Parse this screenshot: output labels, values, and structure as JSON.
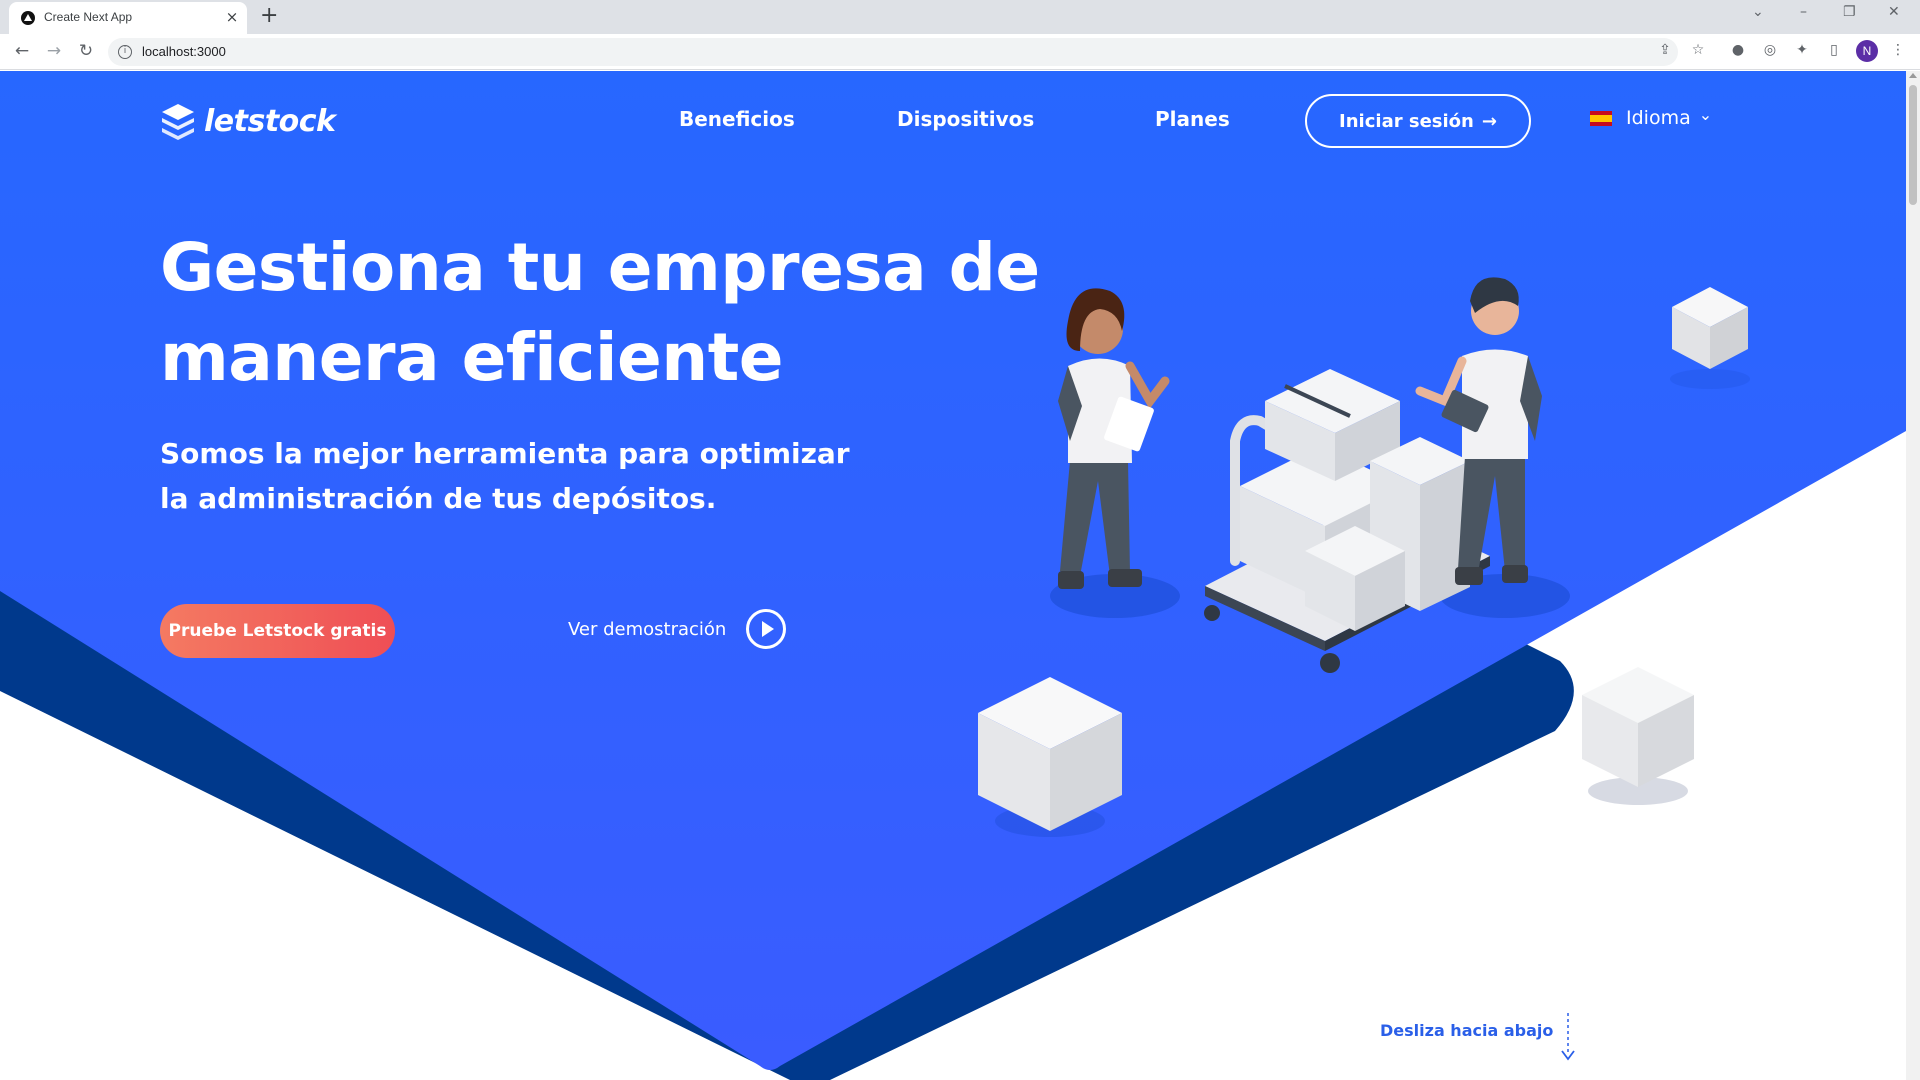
{
  "browser": {
    "tab_title": "Create Next App",
    "new_tab_symbol": "+",
    "tab_close_symbol": "×",
    "url": "localhost:3000",
    "profile_initial": "N"
  },
  "brand": {
    "name": "letstock"
  },
  "nav": {
    "links": [
      "Beneficios",
      "Dispositivos",
      "Planes"
    ],
    "login_label": "Iniciar sesión",
    "login_arrow": "→",
    "language_label": "Idioma",
    "language_chevron": "⌄"
  },
  "hero": {
    "headline_line1": "Gestiona tu empresa de",
    "headline_line2": "manera eficiente",
    "subline": "Somos la mejor herramienta para optimizar la administración de tus depósitos.",
    "cta_label": "Pruebe Letstock gratis",
    "demo_label": "Ver demostración"
  },
  "scroll_hint": "Desliza hacia abajo",
  "colors": {
    "primary_blue": "#2962ff",
    "dark_blue": "#00398c",
    "cta_start": "#f47a62",
    "cta_end": "#ef4e55"
  },
  "icons": [
    "back-icon",
    "forward-icon",
    "reload-icon",
    "info-icon",
    "share-icon",
    "star-icon",
    "extension-icon",
    "sidepanel-icon",
    "play-icon",
    "flag-spain-icon",
    "logo-stack-icon"
  ]
}
